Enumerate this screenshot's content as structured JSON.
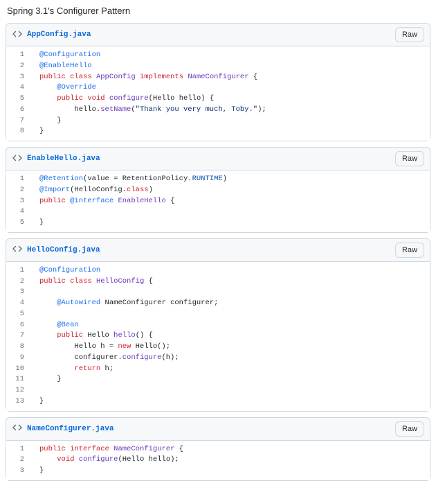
{
  "title": "Spring 3.1's Configurer Pattern",
  "raw_label": "Raw",
  "files": [
    {
      "name": "AppConfig.java",
      "lines": [
        [
          [
            "ann",
            "@Configuration"
          ]
        ],
        [
          [
            "ann",
            "@EnableHello"
          ]
        ],
        [
          [
            "kw",
            "public"
          ],
          [
            "plain",
            " "
          ],
          [
            "kw",
            "class"
          ],
          [
            "plain",
            " "
          ],
          [
            "fn",
            "AppConfig"
          ],
          [
            "plain",
            " "
          ],
          [
            "kw",
            "implements"
          ],
          [
            "plain",
            " "
          ],
          [
            "fn",
            "NameConfigurer"
          ],
          [
            "plain",
            " {"
          ]
        ],
        [
          [
            "plain",
            "    "
          ],
          [
            "ann",
            "@Override"
          ]
        ],
        [
          [
            "plain",
            "    "
          ],
          [
            "kw",
            "public"
          ],
          [
            "plain",
            " "
          ],
          [
            "kw",
            "void"
          ],
          [
            "plain",
            " "
          ],
          [
            "fn",
            "configure"
          ],
          [
            "plain",
            "("
          ],
          [
            "plain",
            "Hello"
          ],
          [
            "plain",
            " "
          ],
          [
            "plain",
            "hello"
          ],
          [
            "plain",
            ") {"
          ]
        ],
        [
          [
            "plain",
            "        hello."
          ],
          [
            "fn",
            "setName"
          ],
          [
            "plain",
            "("
          ],
          [
            "str",
            "\"Thank you very much, Toby.\""
          ],
          [
            "plain",
            ");"
          ]
        ],
        [
          [
            "plain",
            "    }"
          ]
        ],
        [
          [
            "plain",
            "}"
          ]
        ]
      ]
    },
    {
      "name": "EnableHello.java",
      "lines": [
        [
          [
            "ann",
            "@Retention"
          ],
          [
            "plain",
            "("
          ],
          [
            "plain",
            "value"
          ],
          [
            "plain",
            " = "
          ],
          [
            "plain",
            "RetentionPolicy"
          ],
          [
            "plain",
            "."
          ],
          [
            "const",
            "RUNTIME"
          ],
          [
            "plain",
            ")"
          ]
        ],
        [
          [
            "ann",
            "@Import"
          ],
          [
            "plain",
            "("
          ],
          [
            "plain",
            "HelloConfig"
          ],
          [
            "plain",
            "."
          ],
          [
            "kw",
            "class"
          ],
          [
            "plain",
            ")"
          ]
        ],
        [
          [
            "kw",
            "public"
          ],
          [
            "plain",
            " "
          ],
          [
            "ann",
            "@interface"
          ],
          [
            "plain",
            " "
          ],
          [
            "fn",
            "EnableHello"
          ],
          [
            "plain",
            " {"
          ]
        ],
        [
          [
            "plain",
            ""
          ]
        ],
        [
          [
            "plain",
            "}"
          ]
        ]
      ]
    },
    {
      "name": "HelloConfig.java",
      "lines": [
        [
          [
            "ann",
            "@Configuration"
          ]
        ],
        [
          [
            "kw",
            "public"
          ],
          [
            "plain",
            " "
          ],
          [
            "kw",
            "class"
          ],
          [
            "plain",
            " "
          ],
          [
            "fn",
            "HelloConfig"
          ],
          [
            "plain",
            " {"
          ]
        ],
        [
          [
            "plain",
            ""
          ]
        ],
        [
          [
            "plain",
            "    "
          ],
          [
            "ann",
            "@Autowired"
          ],
          [
            "plain",
            " "
          ],
          [
            "plain",
            "NameConfigurer"
          ],
          [
            "plain",
            " configurer;"
          ]
        ],
        [
          [
            "plain",
            ""
          ]
        ],
        [
          [
            "plain",
            "    "
          ],
          [
            "ann",
            "@Bean"
          ]
        ],
        [
          [
            "plain",
            "    "
          ],
          [
            "kw",
            "public"
          ],
          [
            "plain",
            " "
          ],
          [
            "plain",
            "Hello"
          ],
          [
            "plain",
            " "
          ],
          [
            "fn",
            "hello"
          ],
          [
            "plain",
            "() {"
          ]
        ],
        [
          [
            "plain",
            "        Hello h = "
          ],
          [
            "kw",
            "new"
          ],
          [
            "plain",
            " Hello();"
          ]
        ],
        [
          [
            "plain",
            "        configurer."
          ],
          [
            "fn",
            "configure"
          ],
          [
            "plain",
            "(h);"
          ]
        ],
        [
          [
            "plain",
            "        "
          ],
          [
            "kw",
            "return"
          ],
          [
            "plain",
            " h;"
          ]
        ],
        [
          [
            "plain",
            "    }"
          ]
        ],
        [
          [
            "plain",
            ""
          ]
        ],
        [
          [
            "plain",
            "}"
          ]
        ]
      ]
    },
    {
      "name": "NameConfigurer.java",
      "lines": [
        [
          [
            "kw",
            "public"
          ],
          [
            "plain",
            " "
          ],
          [
            "kw",
            "interface"
          ],
          [
            "plain",
            " "
          ],
          [
            "fn",
            "NameConfigurer"
          ],
          [
            "plain",
            " {"
          ]
        ],
        [
          [
            "plain",
            "    "
          ],
          [
            "kw",
            "void"
          ],
          [
            "plain",
            " "
          ],
          [
            "fn",
            "configure"
          ],
          [
            "plain",
            "("
          ],
          [
            "plain",
            "Hello"
          ],
          [
            "plain",
            " "
          ],
          [
            "plain",
            "hello"
          ],
          [
            "plain",
            ");"
          ]
        ],
        [
          [
            "plain",
            "}"
          ]
        ]
      ]
    }
  ]
}
